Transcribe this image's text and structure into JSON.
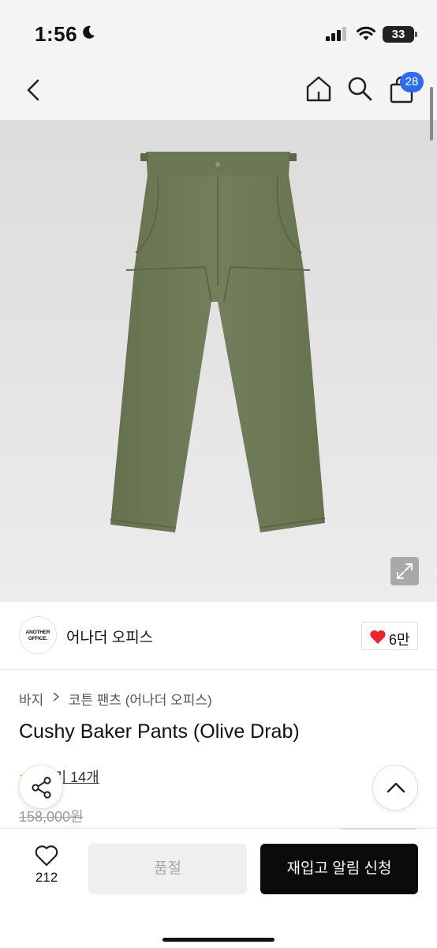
{
  "status_bar": {
    "time": "1:56",
    "battery": "33"
  },
  "nav": {
    "cart_count": "28"
  },
  "brand": {
    "logo_text_line1": "ANOTHER",
    "logo_text_line2": "OFFICE.",
    "name": "어나더 오피스",
    "likes": "6만"
  },
  "breadcrumb": {
    "category": "바지",
    "subcategory": "코튼 팬츠 (어나더 오피스)"
  },
  "product": {
    "title": "Cushy Baker Pants (Olive Drab)",
    "reviews_label": "후기 14개",
    "original_price": "158,000원",
    "color": "#6f7a5a"
  },
  "bottom_bar": {
    "wish_count": "212",
    "soldout_label": "품절",
    "restock_label": "재입고 알림 신청"
  },
  "colors": {
    "accent_blue": "#2d6bf0",
    "like_red": "#e8272b",
    "primary_black": "#0b0b0b"
  }
}
